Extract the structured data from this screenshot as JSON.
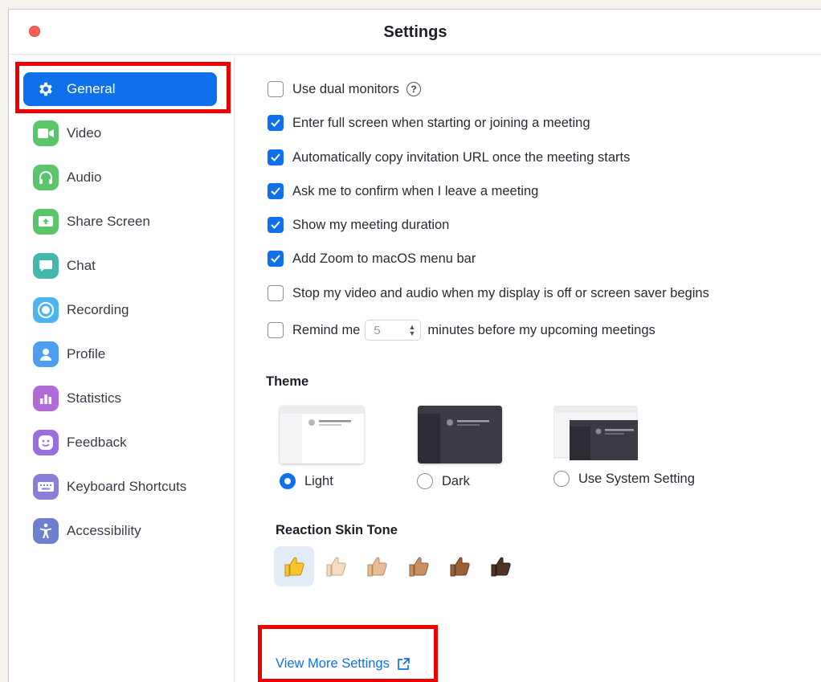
{
  "window": {
    "title": "Settings"
  },
  "sidebar": {
    "items": [
      {
        "label": "General",
        "icon": "gear-icon",
        "color": "#0e71eb",
        "active": true
      },
      {
        "label": "Video",
        "icon": "video-camera-icon",
        "color": "#5ac56b"
      },
      {
        "label": "Audio",
        "icon": "headphones-icon",
        "color": "#5ac56b"
      },
      {
        "label": "Share Screen",
        "icon": "share-screen-icon",
        "color": "#5ac56b"
      },
      {
        "label": "Chat",
        "icon": "chat-bubble-icon",
        "color": "#45b8ad"
      },
      {
        "label": "Recording",
        "icon": "record-icon",
        "color": "#4cb4ee"
      },
      {
        "label": "Profile",
        "icon": "profile-icon",
        "color": "#4c9ff0"
      },
      {
        "label": "Statistics",
        "icon": "bar-chart-icon",
        "color": "#b06bd6"
      },
      {
        "label": "Feedback",
        "icon": "smiley-icon",
        "color": "#9b6ee0"
      },
      {
        "label": "Keyboard Shortcuts",
        "icon": "keyboard-icon",
        "color": "#8a7fd8"
      },
      {
        "label": "Accessibility",
        "icon": "accessibility-icon",
        "color": "#6d7fcf"
      }
    ]
  },
  "general": {
    "options": [
      {
        "label": "Use dual monitors",
        "checked": false,
        "help": "?"
      },
      {
        "label": "Enter full screen when starting or joining a meeting",
        "checked": true
      },
      {
        "label": "Automatically copy invitation URL once the meeting starts",
        "checked": true
      },
      {
        "label": "Ask me to confirm when I leave a meeting",
        "checked": true
      },
      {
        "label": "Show my meeting duration",
        "checked": true
      },
      {
        "label": "Add Zoom to macOS menu bar",
        "checked": true
      },
      {
        "label": "Stop my video and audio when my display is off or screen saver begins",
        "checked": false
      }
    ],
    "remind": {
      "checked": false,
      "label_before": "Remind me",
      "minutes": "5",
      "label_after": "minutes before my upcoming meetings"
    },
    "theme": {
      "title": "Theme",
      "options": [
        {
          "label": "Light",
          "selected": true
        },
        {
          "label": "Dark",
          "selected": false
        },
        {
          "label": "Use System Setting",
          "selected": false
        }
      ]
    },
    "skin_tone": {
      "title": "Reaction Skin Tone",
      "tones": [
        "#f7c531",
        "#f6dcc3",
        "#e6bd94",
        "#c98f63",
        "#9a5f37",
        "#4f3426"
      ],
      "selected_index": 0
    },
    "view_more": {
      "label": "View More Settings",
      "icon": "external-link-icon"
    }
  },
  "accent_color": "#0e71eb",
  "highlight_color": "#ee0000"
}
